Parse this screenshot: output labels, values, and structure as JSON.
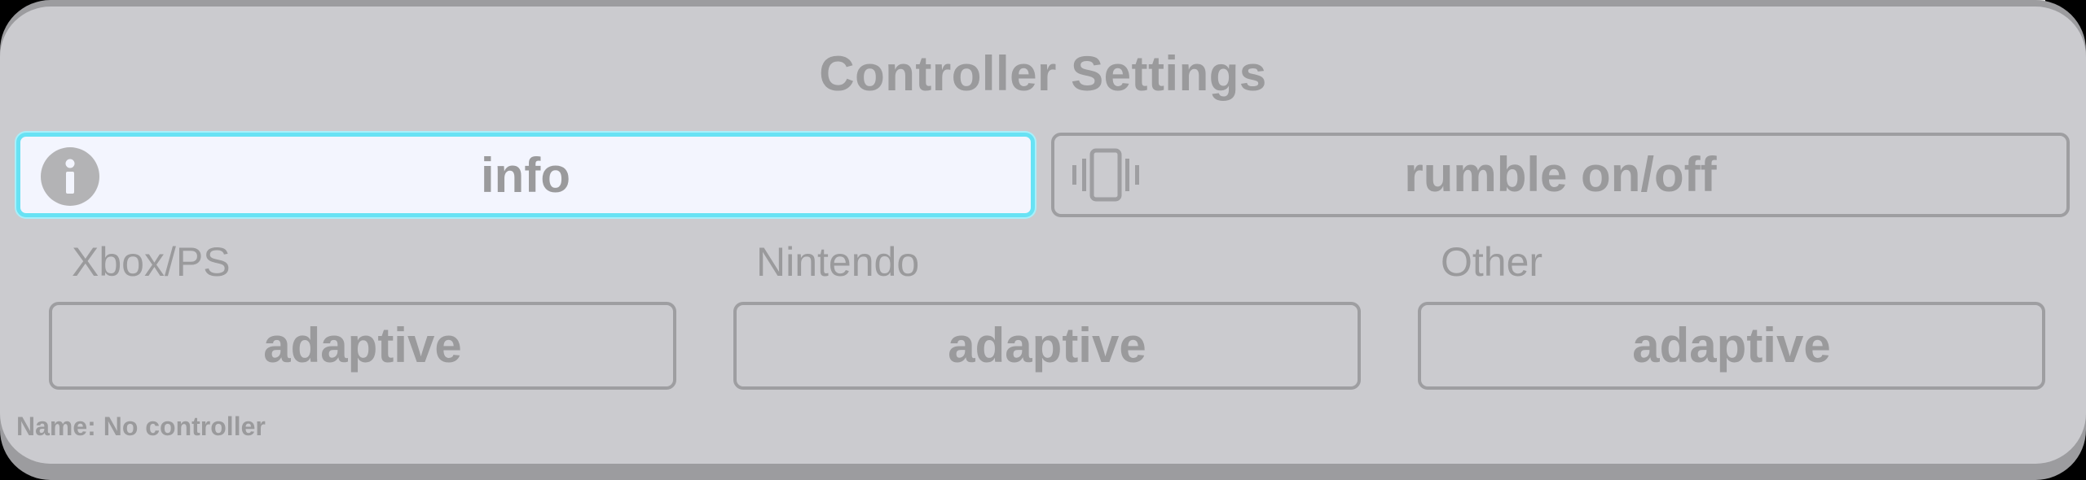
{
  "dialog": {
    "title": "Controller Settings"
  },
  "buttons": {
    "info": {
      "label": "info",
      "icon": "info-icon",
      "focused": true
    },
    "rumble": {
      "label": "rumble on/off",
      "icon": "vibrate-icon"
    }
  },
  "groups": [
    {
      "label": "Xbox/PS",
      "value": "adaptive"
    },
    {
      "label": "Nintendo",
      "value": "adaptive"
    },
    {
      "label": "Other",
      "value": "adaptive"
    }
  ],
  "status": {
    "name_line": "Name: No controller"
  },
  "colors": {
    "panel": "#cbcbcf",
    "text": "#9a9a9c",
    "focus_border": "#68e2f4",
    "focus_fill": "#f3f5fe"
  }
}
